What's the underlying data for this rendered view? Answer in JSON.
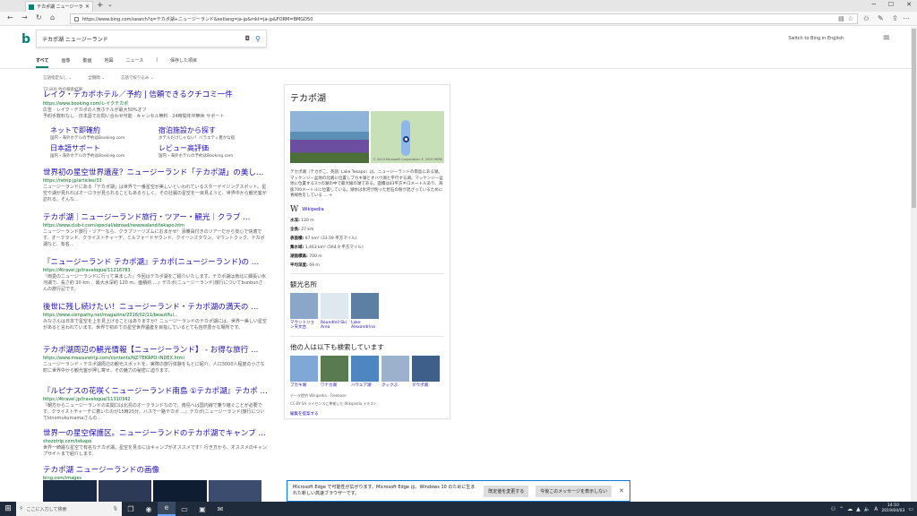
{
  "browser": {
    "tab_title": "テカポ湖 ニュージーランド - B",
    "new_tab": "+",
    "url": "https://www.bing.com/search?q=テカポ湖+ニュージーランド&setlang=ja-jp&mkt=ja-jp&FORM=BMGD50"
  },
  "search": {
    "query": "テカポ湖 ニュージーランド",
    "switch_lang": "Switch to Bing in English",
    "scopes": [
      "すべて",
      "画像",
      "動画",
      "地図",
      "ニュース",
      "|",
      "保存した項目"
    ],
    "filters": [
      "言語指定なし",
      "全期間",
      "言語で絞り込み"
    ],
    "result_count": "72,800 件の検索結果"
  },
  "results": [
    {
      "title": "レイク・テカポホテル／予約 | 信頼できるクチコミ一件",
      "url": "https://www.booking.com/レイクテカポ",
      "snippet": "広告 · レイク・テカポの人気ホテルが最大50%オフ\n予約手数料なし · 日本語でお問い合わせ可能 · キャンセル無料 · 24時間年中無休 サポート",
      "deeplinks": [
        {
          "title": "ネットで即確約",
          "sub": "国内・海外ホテルの予約はBooking.com"
        },
        {
          "title": "宿泊施設から探す",
          "sub": "ホテルだけじゃない！バラエティ豊かな宿"
        },
        {
          "title": "日本語サポート",
          "sub": "国内・海外ホテルの予約はBooking.com"
        },
        {
          "title": "レビュー高評価",
          "sub": "国内・海外ホテルの予約はBooking.com"
        }
      ]
    },
    {
      "title": "世界初の星空世界遺産？ニュージーランド「テカポ湖」の美し…",
      "url": "https://retrip.jp/articles/33",
      "snippet": "ニュージーランドにある「テカポ湖」は世界で一番星空が美しいといわれているスターゲイジングスポット。星空や湖が見れればオーロラが見られることもあるらしく、その壮麗の星空を一目見ようと、世界中から観光客が訪れる。そんな…"
    },
    {
      "title": "テカポ湖｜ニュージーランド旅行・ツアー・観光｜クラブ …",
      "url": "https://www.club-t.com/special/abroad/newzealand/tekapo.htm",
      "snippet": "ニュージーランド旅行・ツアーなら、クラブツーリズムにおまかせ！添乗員付きのツアーだから安心で快適です。オークランド、クライストチャーチ、ミルフォードサウンド、クイーンズタウン、マウントクック、テカポ湖など、有名…"
    },
    {
      "title": "『ニュージーランド テカポ湖』テカポ(ニュージーランド)の …",
      "url": "https://4travel.jp/travelogue/11216783",
      "snippet": "『両愛のニュージーランドに行って来ました』今回はテカポ湖をご紹介いたします。テカポ湖は南北に細長い氷河湖で、長さ約 30 km 、最大水深約 120 m、面積約 …』テカポ(ニュージーランド)旅行についてbunbunさんの旅行記です。"
    },
    {
      "title": "後世に残し続けたい！ニュージーランド・テカポ湖の満天の …",
      "url": "https://www.compathy.net/magazine/2016/02/11/beautiful...",
      "snippet": "みなさんは日本で星空を上を見上げることはありますか？ニュージーランドのテカポ湖には、世界一美しい星空があると言われています。世界で初めての星空世界遺産を目指しているとても自然豊かな場所です。"
    },
    {
      "title": "テカポ湖周辺の観光情報【ニュージーランド】 - お得な旅行 …",
      "url": "https://www.measuretrip.com/contents/NZ-TEKAPO-INDEX.html",
      "snippet": "ニュージーランド・テカポ湖周辺の観光スポットを、実際の旅行体験をもとに紹介。人口3000人程度の小さな町に世界中から観光客が押し寄せ、その魅力の秘密に迫ります。"
    },
    {
      "title": "『ルピナスの花咲くニュージーランド南島 ①テカポ湖』テカポ …",
      "url": "https://4travel.jp/travelogue/11310342",
      "snippet": "『朝方からニュージーランドの玄関口は北島のオークランドなので、南島へは国内線で乗り継ぐことが必要です。クライストチャーチに着いたのが15時25分。バスで一路テカポ …』テカポ(ニュージーランド)旅行についてkinomukumamaさんの…"
    },
    {
      "title": "世界一の星空保護区。ニュージーランドのテカポ湖でキャンプ …",
      "url": "shozotrip.com/tekapo",
      "snippet": "世界一綺麗な星空で有名なテカポ湖。星空を見るにはキャンプがオススメです！行き方から、オススメのキャンプサイトまで紹介します。"
    },
    {
      "title": "テカポ湖 ニュージーランドの画像",
      "url": "bing.com/images",
      "snippet": ""
    }
  ],
  "kp": {
    "title": "テカポ湖",
    "map_credit": "© 2019 Microsoft Corporation © 2019 HERE",
    "description": "テカポ湖（テカポこ、英語: Lake Tekapo）は、ニュージーランドの南島にある湖。マッケンジー盆地の北端に位置しプカキ湖とオハウ湖と平行する湖。マッケンジー盆地に位置する3つの湖の中で最大級の湖である。面積は83平方キロメートルあり、海抜700メートルに位置している。湖水は氷河が削った岩石の粉が混ざっているために青緑色をしている …",
    "more": "+",
    "wiki_glyph": "W",
    "wiki_label": "Wikipedia",
    "facts": [
      {
        "label": "水深:",
        "value": "120 m"
      },
      {
        "label": "全長:",
        "value": "27 km"
      },
      {
        "label": "表面積:",
        "value": "87 km² (33.59 平方マイル)"
      },
      {
        "label": "集水域:",
        "value": "1,463 km² (564.9 平方マイル)"
      },
      {
        "label": "湖面標高:",
        "value": "700 m"
      },
      {
        "label": "平均深度:",
        "value": "69 m"
      }
    ],
    "sights_heading": "観光名所",
    "sights": [
      {
        "label": "マウントジョン天文台",
        "color": "#8aa6c8"
      },
      {
        "label": "Roundhill Ski Area",
        "color": "#dfe7ef"
      },
      {
        "label": "Lake Alexandrina",
        "color": "#5d7fa3"
      }
    ],
    "people_heading": "他の人は以下も検索しています",
    "people": [
      {
        "label": "プカキ湖",
        "color": "#7fa8d6"
      },
      {
        "label": "ワナカ湖",
        "color": "#5a7a52"
      },
      {
        "label": "ハウェア湖",
        "color": "#4e86c2"
      },
      {
        "label": "クックぷ",
        "color": "#9cb2cc"
      },
      {
        "label": "タウポ湖",
        "color": "#3d5f8a"
      }
    ],
    "data_source": "データ提供 Wikipedia · Freebase",
    "license": "CC-BY-SA ライセンスに準拠した Wikipedia テキスト",
    "edit": "編集を提案する"
  },
  "notification": {
    "message": "Microsoft Edge で可能性が広がります。Microsoft Edge は、Windows 10 のために生まれた新しい高速ブラウザーです。",
    "btn_change": "既定値を変更する",
    "btn_dismiss": "今後このメッセージを表示しない"
  },
  "taskbar": {
    "search_placeholder": "ここに入力して検索",
    "time": "14:10",
    "date": "2019/04/03"
  }
}
